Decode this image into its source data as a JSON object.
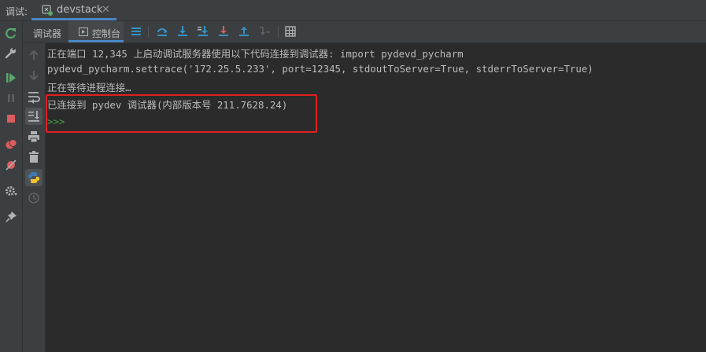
{
  "title_bar": {
    "label": "调试:",
    "run_tab": {
      "label": "devstack",
      "close": "✕",
      "icon": "python-run-config-icon"
    }
  },
  "left_toolbar": {
    "buttons": [
      "rerun-icon",
      "wrench-icon",
      "resume-icon",
      "pause-icon",
      "stop-icon",
      "view-breakpoints-icon",
      "mute-breakpoints-icon",
      "settings-icon",
      "pin-icon"
    ]
  },
  "sub_tabs": {
    "debugger": "调试器",
    "console": "控制台"
  },
  "debug_toolbar": {
    "buttons": [
      "menu-icon",
      "show-execution-point-icon",
      "step-over-icon",
      "step-into-icon",
      "step-into-my-code-icon",
      "force-step-into-icon",
      "step-out-icon",
      "run-to-cursor-icon",
      "evaluate-expression-icon"
    ]
  },
  "console_gutter": {
    "buttons": [
      "up-arrow-icon",
      "down-arrow-icon",
      "soft-wrap-icon",
      "scroll-to-end-icon",
      "print-icon",
      "trash-icon",
      "python-console-icon",
      "history-icon"
    ]
  },
  "console": {
    "lines": [
      "正在端口 12,345 上启动调试服务器使用以下代码连接到调试器: import pydevd_pycharm",
      "pydevd_pycharm.settrace('172.25.5.233', port=12345, stdoutToServer=True, stderrToServer=True)",
      "正在等待进程连接…",
      "已连接到 pydev 调试器(内部版本号 211.7628.24)"
    ],
    "prompt": ">>>"
  },
  "colors": {
    "panel": "#3c3f41",
    "editor": "#2b2b2b",
    "accent": "#4a88c7",
    "green": "#59a869",
    "red": "#db5c5c",
    "blue": "#3592c4",
    "highlight": "#e02020"
  }
}
